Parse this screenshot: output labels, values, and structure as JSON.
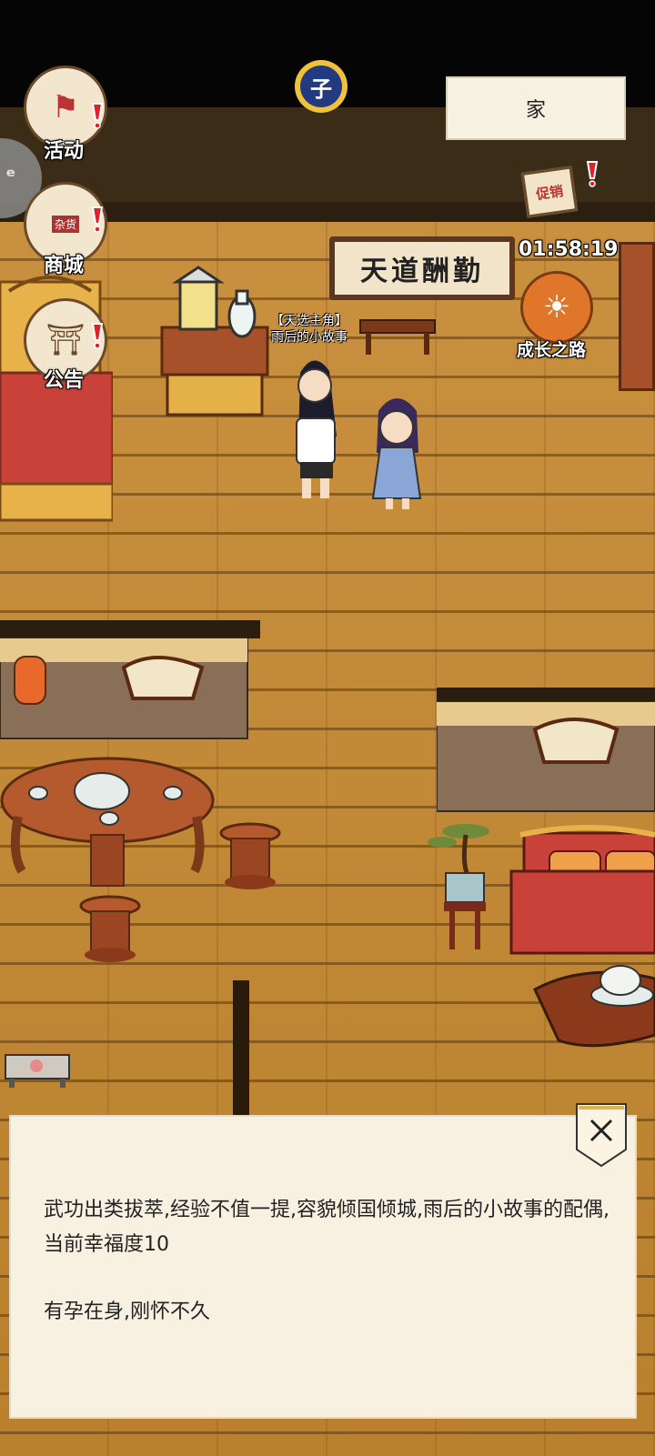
{
  "hud": {
    "activity_label": "活动",
    "shop_label": "商城",
    "shop_badge": "杂货",
    "notice_label": "公告",
    "growth_label": "成长之路",
    "promo_badge": "促销",
    "promo_timer": "01:58:19"
  },
  "time_indicator": "子",
  "location": "家",
  "plaque_text": "天道酬勤",
  "character": {
    "title": "【天选主角】",
    "name": "雨后的小故事"
  },
  "dialog": {
    "line1": "武功出类拔萃,经验不值一提,容貌倾国倾城,雨后的小故事的配偶,当前幸福度10",
    "line2": "有孕在身,刚怀不久"
  },
  "colors": {
    "floor": "#c9913f",
    "alert": "#e0202a",
    "dialog_bg": "#f8f1e2"
  }
}
